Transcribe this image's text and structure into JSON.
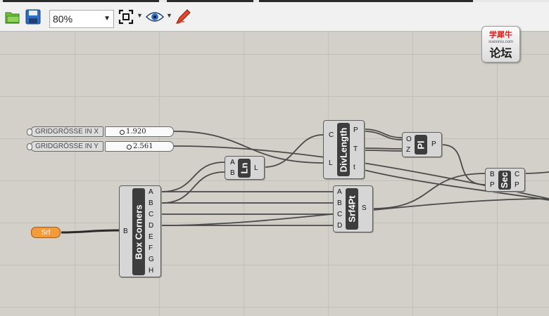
{
  "toolbar": {
    "zoom_value": "80%",
    "icons": [
      "open-file-icon",
      "save-icon",
      "zoom-extents-icon",
      "preview-eye-icon",
      "sketch-pen-icon"
    ]
  },
  "sliders": [
    {
      "label": "GRIDGRÖSSE IN X",
      "value": "1.920"
    },
    {
      "label": "GRIDGRÖSSE IN Y",
      "value": "2.561"
    }
  ],
  "srf_param": {
    "label": "Srf"
  },
  "components": {
    "box_corners": {
      "title": "Box Corners",
      "inputs": [
        "B"
      ],
      "outputs": [
        "A",
        "B",
        "C",
        "D",
        "E",
        "F",
        "G",
        "H"
      ]
    },
    "ln": {
      "title": "Ln",
      "inputs": [
        "A",
        "B"
      ],
      "outputs": [
        "L"
      ]
    },
    "divlength": {
      "title": "DivLength",
      "inputs": [
        "C",
        "L"
      ],
      "outputs": [
        "P",
        "T",
        "t"
      ]
    },
    "srf4pt": {
      "title": "Srf4Pt",
      "inputs": [
        "A",
        "B",
        "C",
        "D"
      ],
      "outputs": [
        "S"
      ]
    },
    "pl": {
      "title": "Pl",
      "inputs": [
        "O",
        "Z"
      ],
      "outputs": [
        "P"
      ]
    },
    "sec": {
      "title": "Sec",
      "inputs": [
        "B",
        "P"
      ],
      "outputs": [
        "C",
        "P"
      ]
    }
  },
  "logo": {
    "line1": "学犀牛",
    "line2": "xuexiniu.com",
    "line3": "论坛"
  },
  "colors": {
    "canvas": "#d3d0c9",
    "wire": "#4a4a4a",
    "srf_param": "#f39a3a"
  }
}
